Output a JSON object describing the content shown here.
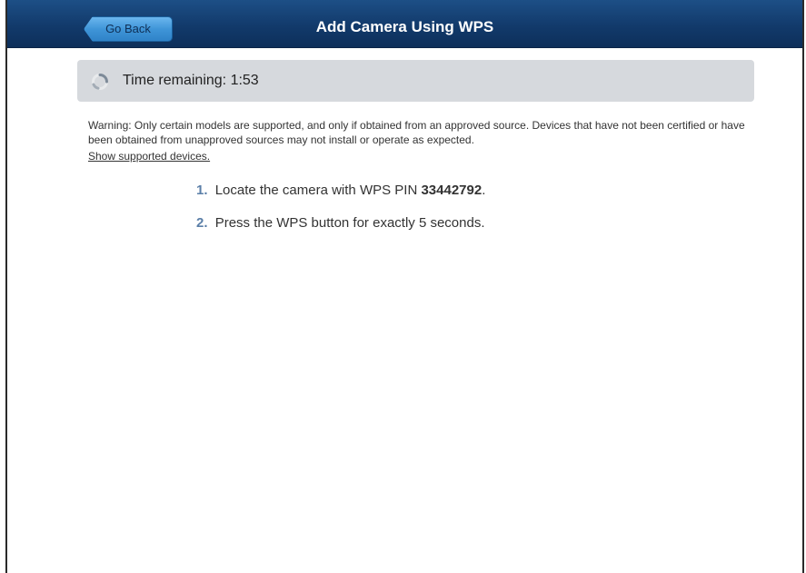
{
  "header": {
    "back_label": "Go Back",
    "title": "Add Camera Using WPS"
  },
  "timer": {
    "label": "Time remaining: ",
    "value": "1:53",
    "icon": "spinner-icon"
  },
  "warning": {
    "text": "Warning: Only certain models are supported, and only if obtained from an approved source. Devices that have not been certified or have been obtained from unapproved sources may not install or operate as expected.",
    "link_label": "Show supported devices."
  },
  "steps": [
    {
      "num": "1.",
      "text_before": "Locate the camera with WPS PIN ",
      "pin": "33442792",
      "text_after": "."
    },
    {
      "num": "2.",
      "text": "Press the WPS button for exactly 5 seconds."
    }
  ],
  "colors": {
    "header_bg": "#123a6b",
    "back_button": "#3f95d8",
    "timer_box": "#d6d9dd",
    "step_number": "#5b7fa8"
  }
}
